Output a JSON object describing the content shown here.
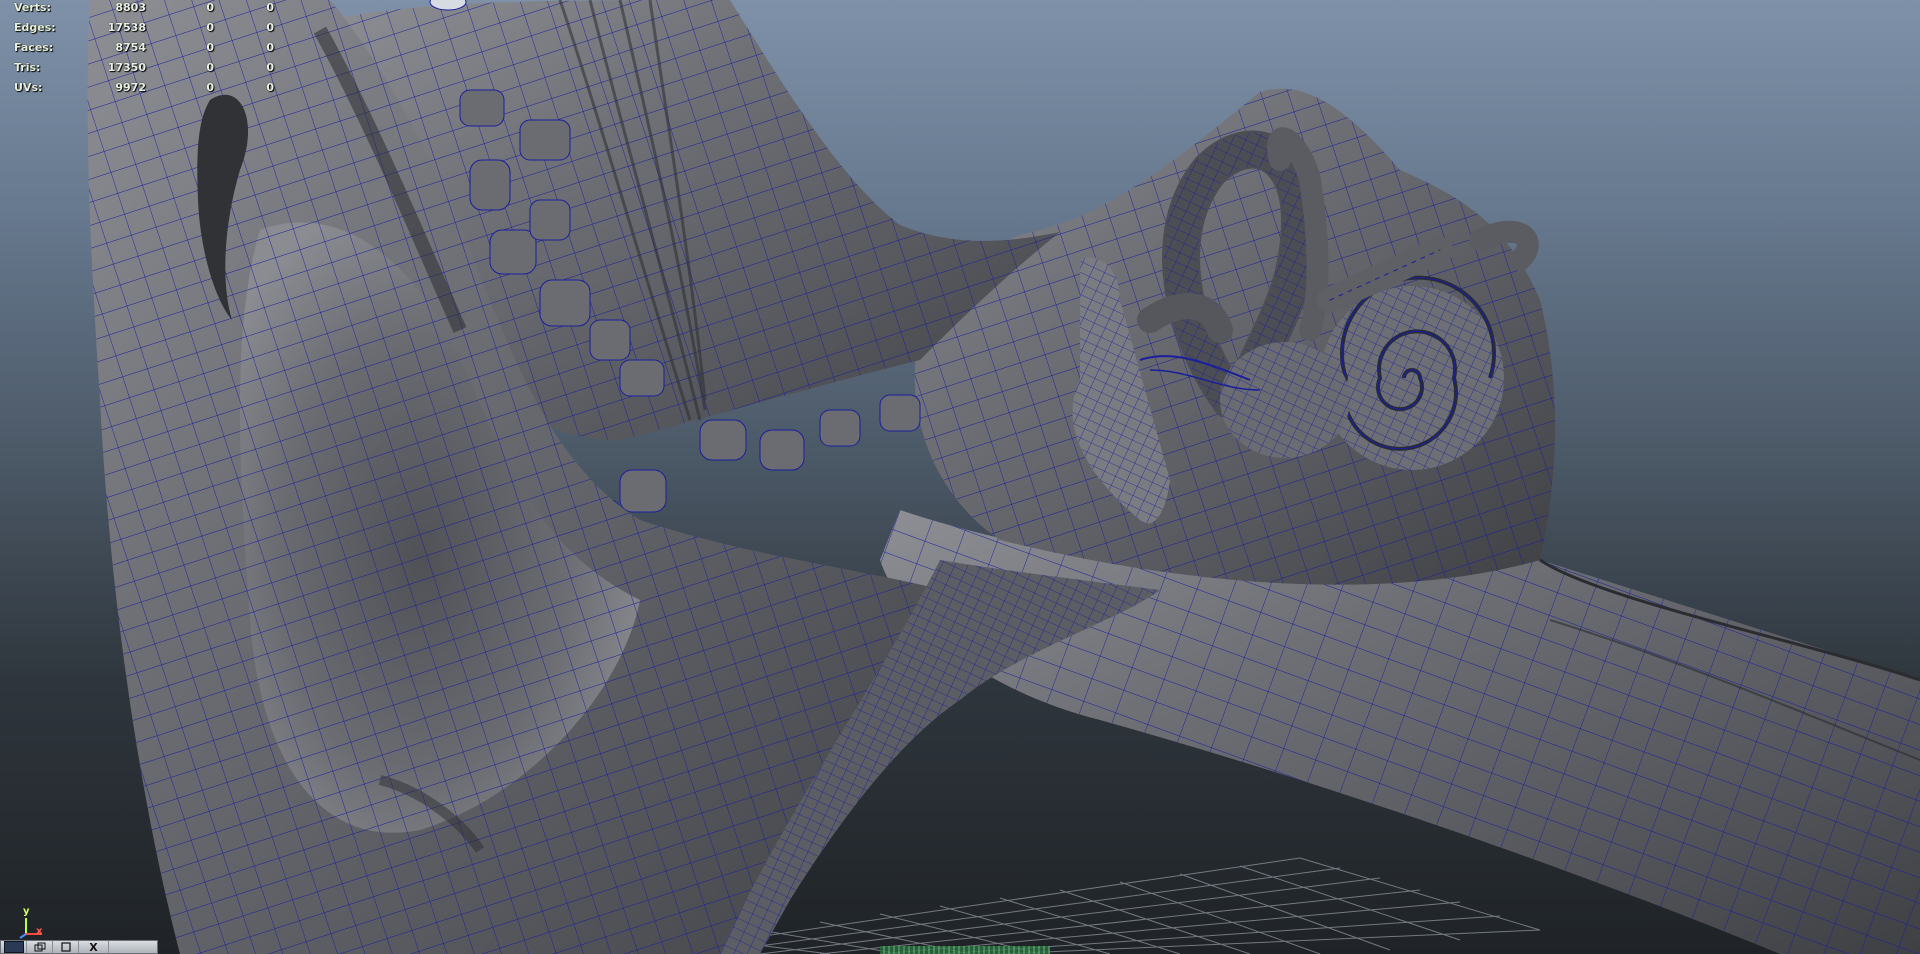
{
  "stats": [
    {
      "label": "Verts:",
      "v1": "8803",
      "v2": "0",
      "v3": "0"
    },
    {
      "label": "Edges:",
      "v1": "17538",
      "v2": "0",
      "v3": "0"
    },
    {
      "label": "Faces:",
      "v1": "8754",
      "v2": "0",
      "v3": "0"
    },
    {
      "label": "Tris:",
      "v1": "17350",
      "v2": "0",
      "v3": "0"
    },
    {
      "label": "UVs:",
      "v1": "9972",
      "v2": "0",
      "v3": "0"
    }
  ],
  "axis": {
    "y": "y",
    "x": "x"
  },
  "toolbar": {
    "close_label": "X"
  },
  "colors": {
    "wire": "#1a1e9c",
    "mesh_light": "#8b8d94",
    "mesh_dark": "#2f3034",
    "grid": "#8f969e",
    "sky_top": "#7f91a8",
    "floor": "#1f2327"
  }
}
